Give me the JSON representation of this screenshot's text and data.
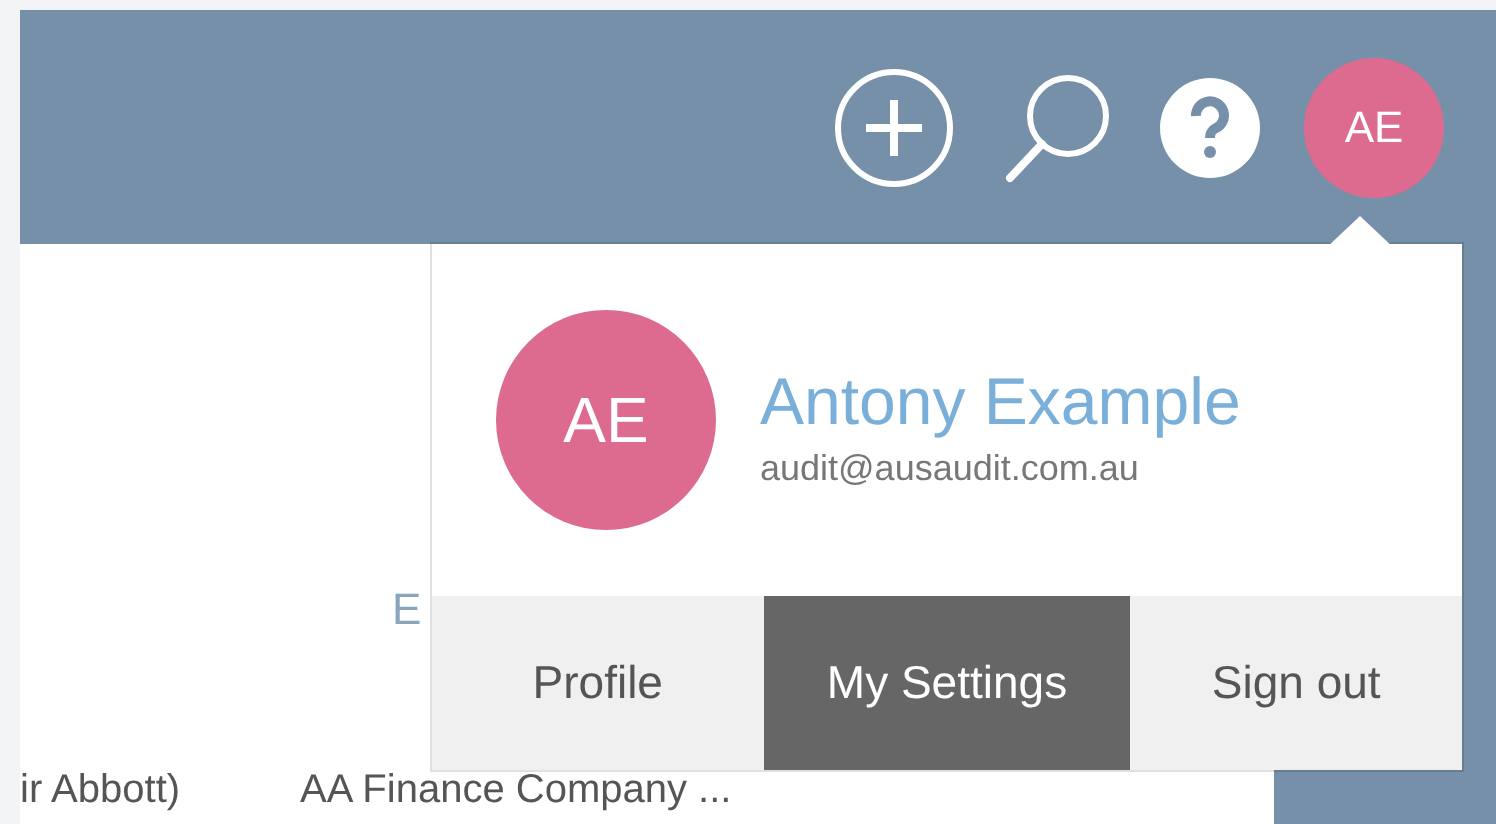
{
  "header": {
    "avatar_initials": "AE"
  },
  "table": {
    "column_2_heading": "E",
    "row_cells": [
      "ir Abbott)",
      "AA Finance Company ..."
    ]
  },
  "user_menu": {
    "initials": "AE",
    "name": "Antony Example",
    "email": "audit@ausaudit.com.au",
    "items": [
      {
        "label": "Profile",
        "selected": false
      },
      {
        "label": "My Settings",
        "selected": true
      },
      {
        "label": "Sign out",
        "selected": false
      }
    ]
  }
}
